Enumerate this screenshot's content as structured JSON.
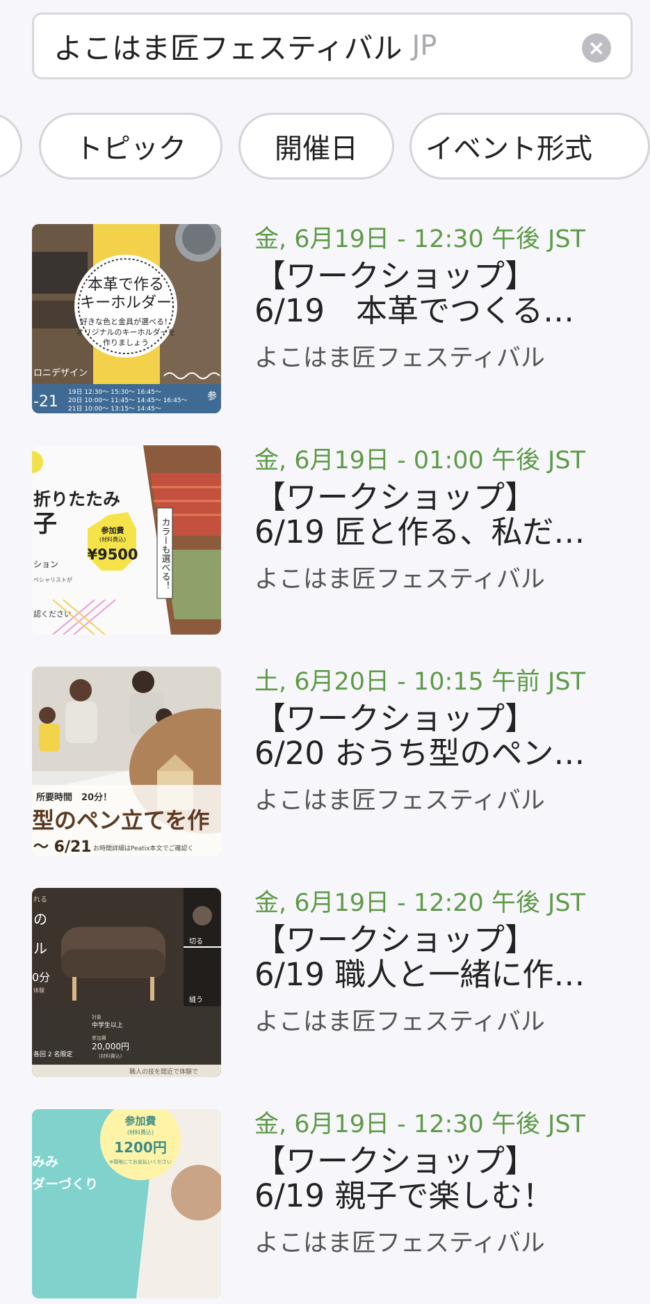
{
  "search": {
    "query": "よこはま匠フェスティバル",
    "location": "JP"
  },
  "filters": [
    "トピック",
    "開催日",
    "イベント形式"
  ],
  "events": [
    {
      "date": "金, 6月19日 - 12:30 午後 JST",
      "title_line1": "【ワークショップ】",
      "title_line2": "6/19　本革でつくる…",
      "organizer": "よこはま匠フェスティバル",
      "thumb": {
        "text1": "本革で作る",
        "text2": "キーホルダー",
        "text3": "好きな色と金具が選べる！",
        "text4": "オリジナルのキーホルダーを",
        "text5": "作りましょう",
        "corner": "ロニデザイン",
        "range": "-21",
        "schedule1": "19日 12:30〜 15:30〜 16:45〜",
        "schedule2": "20日 10:00〜 11:45〜 14:45〜 16:45〜",
        "schedule3": "21日 10:00〜 13:15〜 14:45〜",
        "tag": "参"
      }
    },
    {
      "date": "金, 6月19日 - 01:00 午後 JST",
      "title_line1": "【ワークショップ】",
      "title_line2": "6/19 匠と作る、私だ…",
      "organizer": "よこはま匠フェスティバル",
      "thumb": {
        "text1": "折りたたみ",
        "text2": "子",
        "price_label": "参加費",
        "price_note": "(材料費込)",
        "price": "¥9500",
        "side": "カラーも選べる！",
        "small1": "ション",
        "small2": "ペシャリストが",
        "small3": "認ください"
      }
    },
    {
      "date": "土, 6月20日 - 10:15 午前 JST",
      "title_line1": "【ワークショップ】",
      "title_line2": "6/20 おうち型のペン…",
      "organizer": "よこはま匠フェスティバル",
      "thumb": {
        "time": "所要時間　20分！",
        "big": "型のペン立てを作",
        "range": "〜 6/21",
        "note": "お時間詳細はPeatix本文でご確認く"
      }
    },
    {
      "date": "金, 6月19日 - 12:20 午後 JST",
      "title_line1": "【ワークショップ】",
      "title_line2": "6/19 職人と一緒に作…",
      "organizer": "よこはま匠フェスティバル",
      "thumb": {
        "top": "れる",
        "t1": "の",
        "t2": "ル",
        "t3": "0分",
        "t4": "体験",
        "cut": "切る",
        "sew": "縫う",
        "target_label": "対象",
        "target": "中学生以上",
        "fee_label": "参加費",
        "fee": "20,000円",
        "fee_note": "(材料費込)",
        "limit": "各回 2 名限定",
        "footer": "職人の技を間近で体験で"
      }
    },
    {
      "date": "金, 6月19日 - 12:30 午後 JST",
      "title_line1": "【ワークショップ】",
      "title_line2": "6/19 親子で楽しむ！",
      "organizer": "よこはま匠フェスティバル",
      "thumb": {
        "label": "参加費",
        "note": "(材料費込)",
        "price": "1200円",
        "sub": "※現地にてお支払いください",
        "left1": "みみ",
        "left2": "ダーづくり"
      }
    }
  ]
}
